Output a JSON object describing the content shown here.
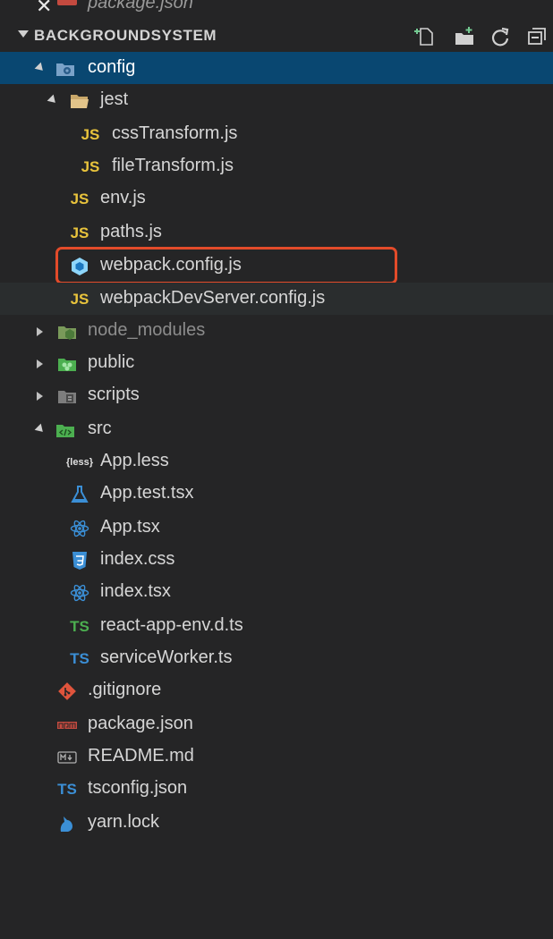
{
  "top_partial": {
    "label": "package.json"
  },
  "explorer": {
    "section_title": "BACKGROUNDSYSTEM",
    "actions": [
      {
        "name": "new-file-icon"
      },
      {
        "name": "new-folder-icon"
      },
      {
        "name": "refresh-icon"
      },
      {
        "name": "collapse-all-icon"
      }
    ]
  },
  "tree": {
    "config": "config",
    "jest": "jest",
    "cssTransform": "cssTransform.js",
    "fileTransform": "fileTransform.js",
    "env": "env.js",
    "paths": "paths.js",
    "webpack_config": "webpack.config.js",
    "webpack_dev": "webpackDevServer.config.js",
    "node_modules": "node_modules",
    "public": "public",
    "scripts": "scripts",
    "src": "src",
    "app_less": "App.less",
    "app_test": "App.test.tsx",
    "app_tsx": "App.tsx",
    "index_css": "index.css",
    "index_tsx": "index.tsx",
    "react_env": "react-app-env.d.ts",
    "service_worker": "serviceWorker.ts",
    "gitignore": ".gitignore",
    "package_json": "package.json",
    "readme": "README.md",
    "tsconfig": "tsconfig.json",
    "yarn_lock": "yarn.lock"
  },
  "badges": {
    "js": "JS",
    "ts": "TS",
    "less": "{less}"
  },
  "colors": {
    "background": "#252526",
    "selected_row": "#094771",
    "highlight_border": "#e34b2a",
    "js_yellow": "#e8c33c",
    "ts_green": "#4caf50",
    "ts_blue": "#3b8fd6"
  }
}
